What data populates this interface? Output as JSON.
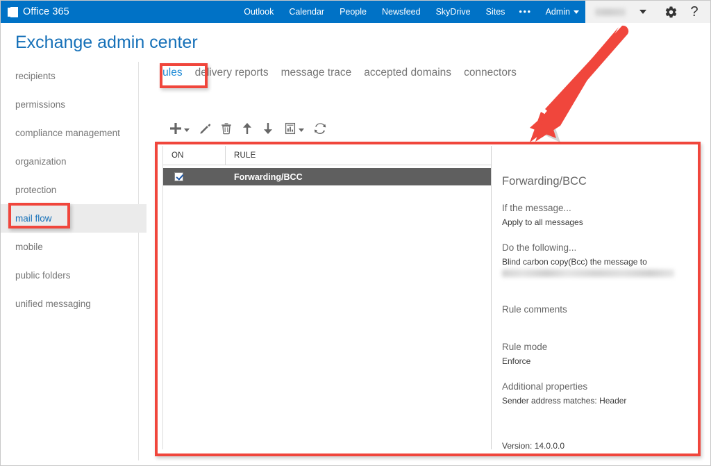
{
  "suite": {
    "brand": "Office 365",
    "brand_icon": "office-logo-icon",
    "nav": [
      {
        "label": "Outlook",
        "name": "outlook"
      },
      {
        "label": "Calendar",
        "name": "calendar"
      },
      {
        "label": "People",
        "name": "people"
      },
      {
        "label": "Newsfeed",
        "name": "newsfeed"
      },
      {
        "label": "SkyDrive",
        "name": "skydrive"
      },
      {
        "label": "Sites",
        "name": "sites"
      },
      {
        "label": "•••",
        "name": "more"
      },
      {
        "label": "Admin",
        "name": "admin"
      }
    ],
    "user_name": "",
    "settings_icon": "gear-icon",
    "help_icon": "question-mark-icon",
    "help_glyph": "?",
    "accent_color": "#0072c6"
  },
  "page": {
    "title": "Exchange admin center",
    "title_color": "#1570b8"
  },
  "sidebar": {
    "items": [
      {
        "label": "recipients",
        "selected": false
      },
      {
        "label": "permissions",
        "selected": false
      },
      {
        "label": "compliance management",
        "selected": false
      },
      {
        "label": "organization",
        "selected": false
      },
      {
        "label": "protection",
        "selected": false
      },
      {
        "label": "mail flow",
        "selected": true
      },
      {
        "label": "mobile",
        "selected": false
      },
      {
        "label": "public folders",
        "selected": false
      },
      {
        "label": "unified messaging",
        "selected": false
      }
    ]
  },
  "tabs": [
    {
      "label": "rules",
      "active": true
    },
    {
      "label": "delivery reports",
      "active": false
    },
    {
      "label": "message trace",
      "active": false
    },
    {
      "label": "accepted domains",
      "active": false
    },
    {
      "label": "connectors",
      "active": false
    }
  ],
  "toolbar": {
    "buttons": [
      {
        "name": "new-rule-button",
        "icon": "plus-icon",
        "has_dropdown": true
      },
      {
        "name": "edit-rule-button",
        "icon": "pencil-icon",
        "has_dropdown": false
      },
      {
        "name": "delete-rule-button",
        "icon": "trash-icon",
        "has_dropdown": false
      },
      {
        "name": "move-up-button",
        "icon": "arrow-up-icon",
        "has_dropdown": false
      },
      {
        "name": "move-down-button",
        "icon": "arrow-down-icon",
        "has_dropdown": false
      },
      {
        "name": "reports-button",
        "icon": "report-chart-icon",
        "has_dropdown": true
      },
      {
        "name": "refresh-button",
        "icon": "refresh-icon",
        "has_dropdown": false
      }
    ]
  },
  "grid": {
    "columns": [
      {
        "key": "on",
        "label": "ON"
      },
      {
        "key": "rule",
        "label": "RULE"
      }
    ],
    "rows": [
      {
        "on": true,
        "rule": "Forwarding/BCC",
        "selected": true
      }
    ]
  },
  "details": {
    "title": "Forwarding/BCC",
    "condition_header": "If the message...",
    "condition_value": "Apply to all messages",
    "action_header": "Do the following...",
    "action_value": "Blind carbon copy(Bcc) the message to",
    "action_recipient_redacted": "",
    "comments_header": "Rule comments",
    "comments_value": "",
    "mode_header": "Rule mode",
    "mode_value": "Enforce",
    "additional_header": "Additional properties",
    "additional_value": "Sender address matches: Header",
    "version": "Version: 14.0.0.0"
  },
  "annotations": {
    "color": "#f0463c",
    "boxes": [
      {
        "name": "rules-tab-highlight"
      },
      {
        "name": "mail-flow-highlight"
      },
      {
        "name": "main-content-highlight"
      }
    ],
    "arrow": {
      "name": "callout-arrow",
      "points_to": "main-content-highlight"
    }
  }
}
